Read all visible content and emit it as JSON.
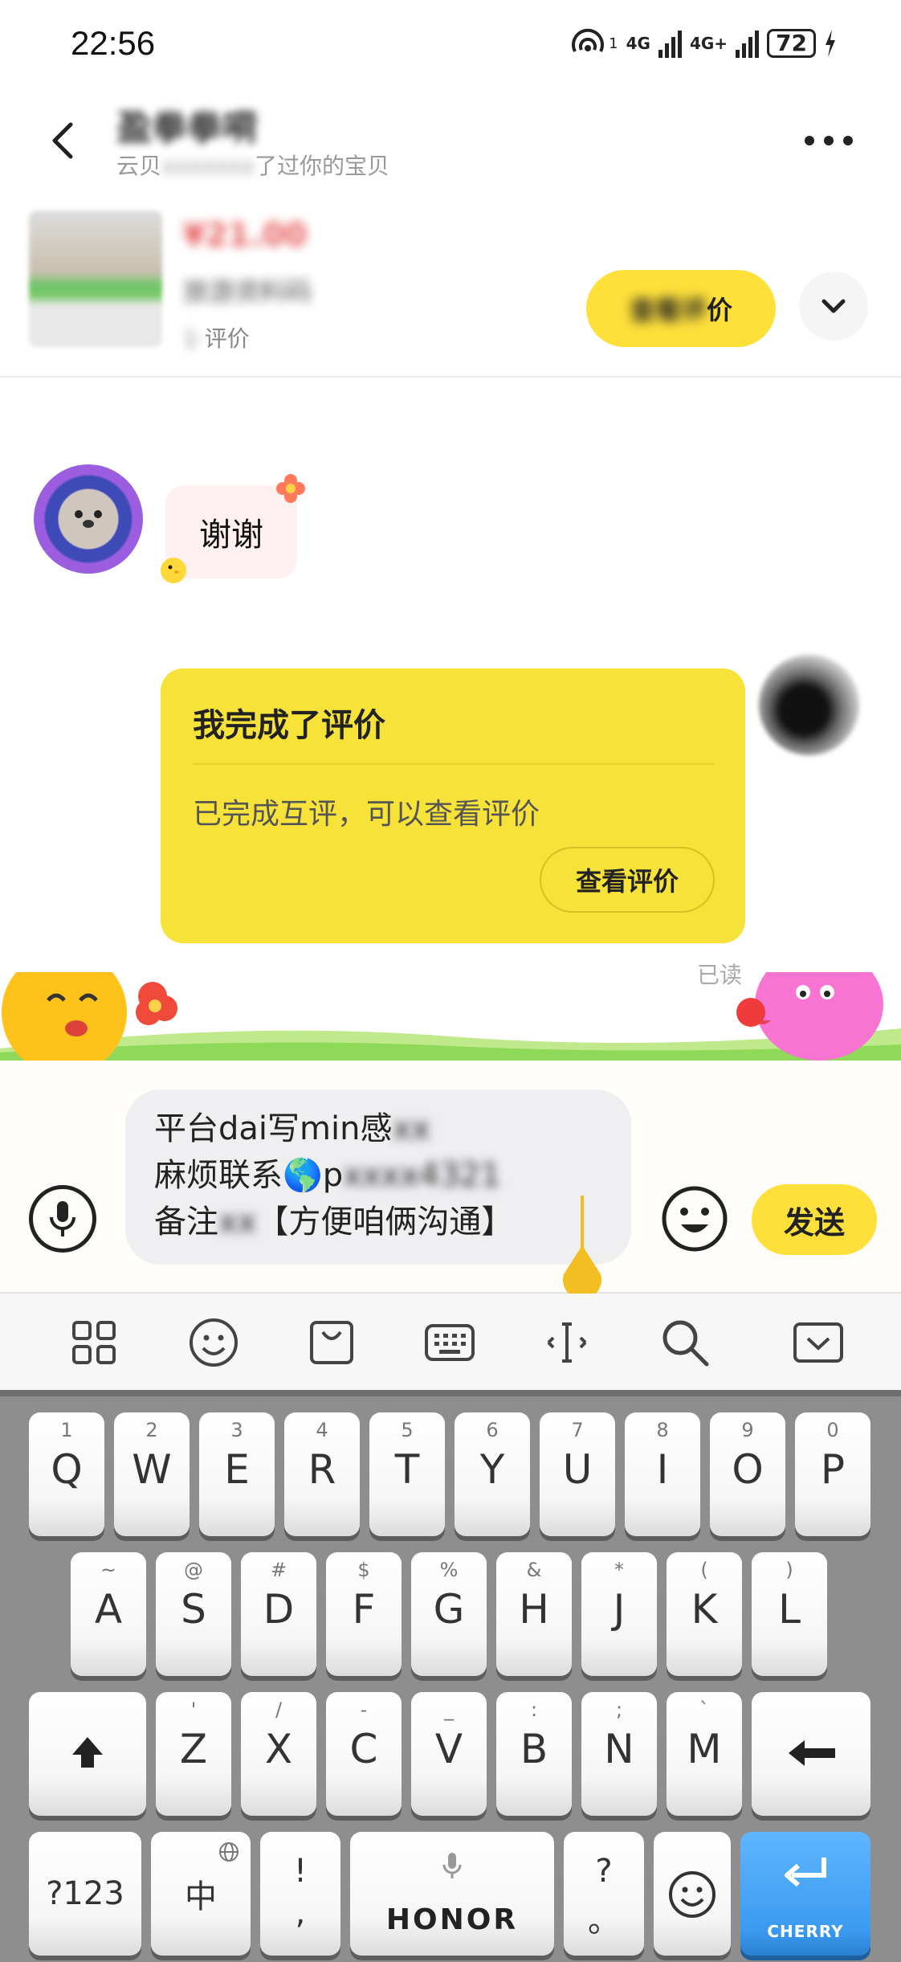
{
  "status_bar": {
    "time": "22:56",
    "network_1": "4G",
    "network_2": "4G+",
    "sim1": "1",
    "battery": "72"
  },
  "header": {
    "title": "盈拳拳嗬",
    "subtitle_prefix": "云贝",
    "subtitle_mid": "xxxxxxx",
    "subtitle_suffix": "了过你的宝贝"
  },
  "product": {
    "price": "¥21.00",
    "name": "旅游资料码",
    "meta_blur": "1·",
    "meta_suffix": "评价",
    "action_blur": "查看评",
    "action_suffix": "价"
  },
  "chat": {
    "left_message": "谢谢",
    "review_card": {
      "title": "我完成了评价",
      "description": "已完成互评，可以查看评价",
      "button": "查看评价"
    },
    "read_status": "已读"
  },
  "input": {
    "line1_visible": "平台dai写min感",
    "line1_blur": "xx",
    "line2_prefix": "麻烦联系🌎p",
    "line2_blur": "xxxx4321",
    "line3_prefix": "备注",
    "line3_blur": "xx",
    "line3_suffix": "【方便咱俩沟通】",
    "send_label": "发送"
  },
  "keyboard": {
    "row1": [
      {
        "sub": "1",
        "main": "Q"
      },
      {
        "sub": "2",
        "main": "W"
      },
      {
        "sub": "3",
        "main": "E"
      },
      {
        "sub": "4",
        "main": "R"
      },
      {
        "sub": "5",
        "main": "T"
      },
      {
        "sub": "6",
        "main": "Y"
      },
      {
        "sub": "7",
        "main": "U"
      },
      {
        "sub": "8",
        "main": "I"
      },
      {
        "sub": "9",
        "main": "O"
      },
      {
        "sub": "0",
        "main": "P"
      }
    ],
    "row2": [
      {
        "sub": "~",
        "main": "A"
      },
      {
        "sub": "@",
        "main": "S"
      },
      {
        "sub": "#",
        "main": "D"
      },
      {
        "sub": "$",
        "main": "F"
      },
      {
        "sub": "%",
        "main": "G"
      },
      {
        "sub": "&",
        "main": "H"
      },
      {
        "sub": "*",
        "main": "J"
      },
      {
        "sub": "(",
        "main": "K"
      },
      {
        "sub": ")",
        "main": "L"
      }
    ],
    "row3": [
      {
        "sub": "'",
        "main": "Z"
      },
      {
        "sub": "/",
        "main": "X"
      },
      {
        "sub": "-",
        "main": "C"
      },
      {
        "sub": "_",
        "main": "V"
      },
      {
        "sub": ":",
        "main": "B"
      },
      {
        "sub": ";",
        "main": "N"
      },
      {
        "sub": "`",
        "main": "M"
      }
    ],
    "sym_key": "?123",
    "lang_key": "中",
    "punct1_top": "!",
    "punct1_bottom": ",",
    "space_label": "HONOR",
    "punct2_top": "?",
    "punct2_bottom": "。",
    "enter_brand": "CHERRY"
  },
  "colors": {
    "accent_yellow": "#ffe03b",
    "card_yellow": "#f7e23a",
    "enter_blue": "#3b9af0",
    "price_red": "#e65a5a"
  }
}
